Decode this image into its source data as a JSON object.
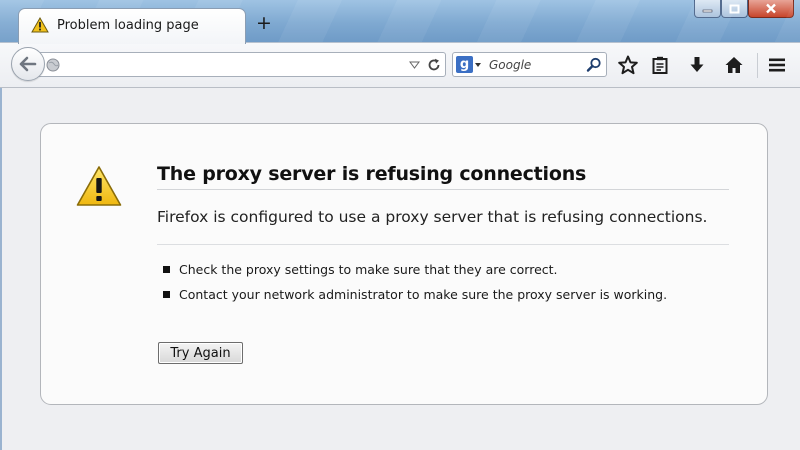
{
  "tab": {
    "title": "Problem loading page",
    "new_tab_label": "+"
  },
  "navbar": {
    "url_value": "",
    "search_placeholder": "Google"
  },
  "error": {
    "title": "The proxy server is refusing connections",
    "description": "Firefox is configured to use a proxy server that is refusing connections.",
    "suggestions": [
      "Check the proxy settings to make sure that they are correct.",
      "Contact your network administrator to make sure the proxy server is working."
    ],
    "button_label": "Try Again"
  },
  "icons": {
    "tab": "warning-icon",
    "titlebar": [
      "minimize-icon",
      "maximize-icon",
      "close-icon"
    ],
    "navbar": [
      "back-arrow-icon",
      "globe-icon",
      "dropdown-triangle-icon",
      "reload-icon",
      "google-g-icon",
      "search-magnifier-icon",
      "star-icon",
      "clipboard-icon",
      "download-arrow-icon",
      "home-icon",
      "hamburger-menu-icon"
    ],
    "content": "alert-triangle-icon"
  },
  "colors": {
    "titlebar": "#7fa9d1",
    "close_button": "#c7452b",
    "alert_yellow": "#f3c21a",
    "content_background": "#eeeff2"
  }
}
